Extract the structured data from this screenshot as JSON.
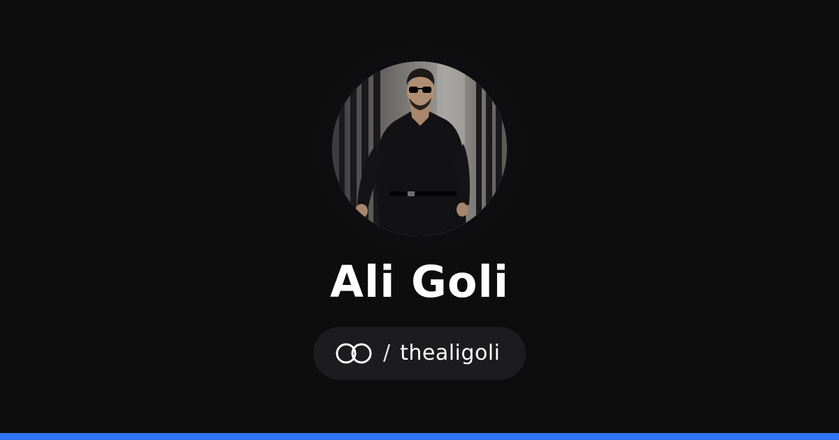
{
  "profile": {
    "name": "Ali Goli",
    "separator": "/",
    "handle": "thealigoli",
    "avatar_description": "profile photo of man in black shirt and sunglasses",
    "icons": {
      "link": "linked-rings-icon"
    }
  },
  "colors": {
    "background": "#0d0d0e",
    "pill": "#1c1c1e",
    "accent_bar": "#2f74f2",
    "text": "#ffffff"
  }
}
